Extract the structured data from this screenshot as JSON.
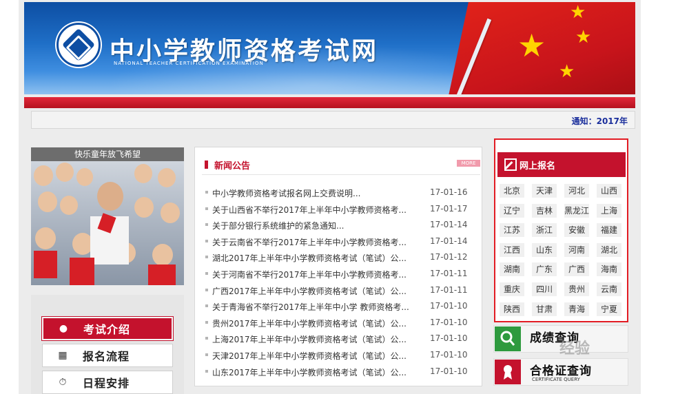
{
  "header": {
    "site_title": "中小学教师资格考试网",
    "site_subtitle": "NATIONAL TEACHER CERTIFICATION EXAMINATION"
  },
  "notice": {
    "text": "通知：2017年"
  },
  "photo": {
    "caption": "快乐童年放飞希望"
  },
  "side_menu": {
    "items": [
      {
        "label": "考试介绍",
        "icon": "user-icon",
        "active": true
      },
      {
        "label": "报名流程",
        "icon": "sitemap-icon",
        "active": false
      },
      {
        "label": "日程安排",
        "icon": "stopwatch-icon",
        "active": false
      }
    ]
  },
  "news": {
    "title": "新闻公告",
    "more_label": "MORE",
    "items": [
      {
        "title": "中小学教师资格考试报名网上交费说明...",
        "date": "17-01-16"
      },
      {
        "title": "关于山西省不举行2017年上半年中小学教师资格考...",
        "date": "17-01-17"
      },
      {
        "title": "关于部分银行系统维护的紧急通知...",
        "date": "17-01-14"
      },
      {
        "title": "关于云南省不举行2017年上半年中小学教师资格考...",
        "date": "17-01-14"
      },
      {
        "title": "湖北2017年上半年中小学教师资格考试（笔试）公...",
        "date": "17-01-12"
      },
      {
        "title": "关于河南省不举行2017年上半年中小学教师资格考...",
        "date": "17-01-11"
      },
      {
        "title": "广西2017年上半年中小学教师资格考试（笔试）公...",
        "date": "17-01-11"
      },
      {
        "title": "关于青海省不举行2017年上半年中小学 教师资格考...",
        "date": "17-01-10"
      },
      {
        "title": "贵州2017年上半年中小学教师资格考试（笔试）公...",
        "date": "17-01-10"
      },
      {
        "title": "上海2017年上半年中小学教师资格考试（笔试）公...",
        "date": "17-01-10"
      },
      {
        "title": "天津2017年上半年中小学教师资格考试（笔试）公...",
        "date": "17-01-10"
      },
      {
        "title": "山东2017年上半年中小学教师资格考试（笔试）公...",
        "date": "17-01-10"
      }
    ]
  },
  "registration": {
    "title": "网上报名",
    "provinces": [
      "北京",
      "天津",
      "河北",
      "山西",
      "辽宁",
      "吉林",
      "黑龙江",
      "上海",
      "江苏",
      "浙江",
      "安徽",
      "福建",
      "江西",
      "山东",
      "河南",
      "湖北",
      "湖南",
      "广东",
      "广西",
      "海南",
      "重庆",
      "四川",
      "贵州",
      "云南",
      "陕西",
      "甘肃",
      "青海",
      "宁夏"
    ]
  },
  "queries": [
    {
      "title": "成绩查询",
      "subtitle": "",
      "icon": "magnifier-icon",
      "icon_color": "#2e9a3e"
    },
    {
      "title": "合格证查询",
      "subtitle": "CERTIFICATE QUERY",
      "icon": "award-icon",
      "icon_color": "#c4122d"
    }
  ],
  "watermark": {
    "text": "经验"
  },
  "colors": {
    "brand_red": "#c4122d",
    "brand_blue": "#0d4ea3",
    "notice_blue": "#1b2f9c"
  }
}
